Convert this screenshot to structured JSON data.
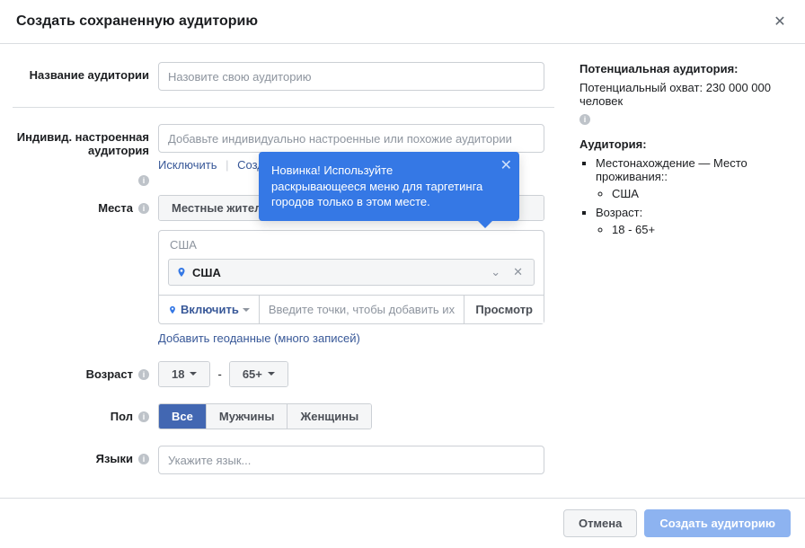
{
  "header": {
    "title": "Создать сохраненную аудиторию"
  },
  "labels": {
    "audience_name": "Название аудитории",
    "custom_audience": "Индивид. настроенная аудитория",
    "locations": "Места",
    "age": "Возраст",
    "gender": "Пол",
    "languages": "Языки"
  },
  "placeholders": {
    "audience_name": "Назовите свою аудиторию",
    "custom_audience": "Добавьте индивидуально настроенные или похожие аудитории",
    "location_input": "Введите точки, чтобы добавить их",
    "languages": "Укажите язык..."
  },
  "custom_audience_links": {
    "exclude": "Исключить",
    "create": "Создать"
  },
  "locations": {
    "dropdown_selected": "Местные жители",
    "group_label": "США",
    "chip_name": "США",
    "include_btn": "Включить",
    "browse_btn": "Просмотр",
    "add_bulk": "Добавить геоданные (много записей)"
  },
  "tooltip": {
    "text": "Новинка! Используйте раскрывающееся меню для таргетинга городов только в этом месте."
  },
  "age": {
    "min": "18",
    "max": "65+"
  },
  "gender": {
    "all": "Все",
    "men": "Мужчины",
    "women": "Женщины",
    "active": "all"
  },
  "sidebar": {
    "potential_title": "Потенциальная аудитория:",
    "reach_label": "Потенциальный охват:",
    "reach_value": "230 000 000 человек",
    "audience_title": "Аудитория:",
    "items": [
      {
        "label": "Местонахождение — Место проживания::",
        "sub": [
          "США"
        ]
      },
      {
        "label": "Возраст:",
        "sub": [
          "18 - 65+"
        ]
      }
    ]
  },
  "footer": {
    "cancel": "Отмена",
    "create": "Создать аудиторию"
  }
}
